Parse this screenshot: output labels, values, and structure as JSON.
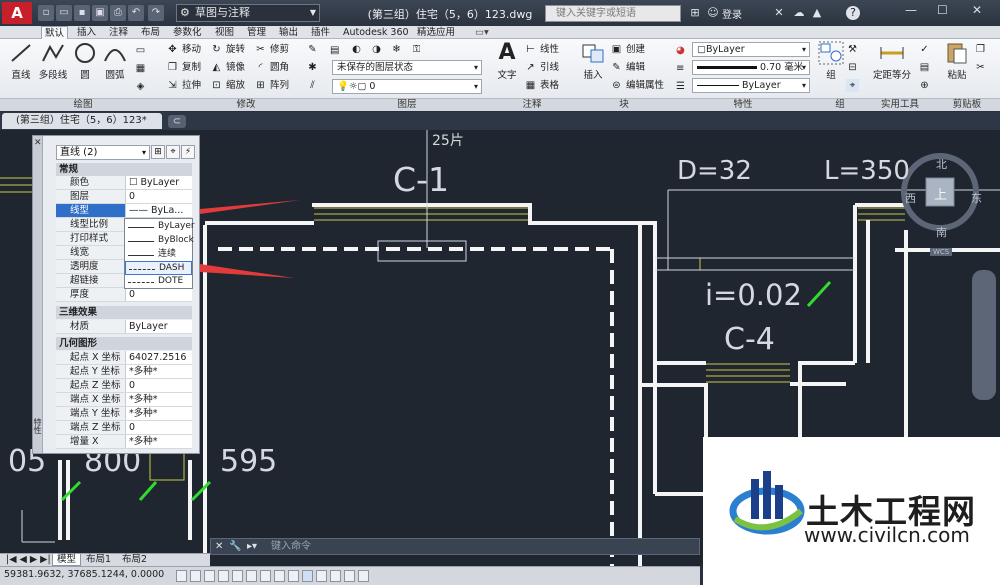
{
  "titlebar": {
    "logo": "A",
    "workspace": "草图与注释",
    "document_title": "(第三组）住宅（5，6）123.dwg",
    "search_placeholder": "键入关键字或短语",
    "login_label": "登录",
    "help_label": "?"
  },
  "menu_tabs": [
    "默认",
    "插入",
    "注释",
    "布局",
    "参数化",
    "视图",
    "管理",
    "输出",
    "插件",
    "Autodesk 360",
    "精选应用"
  ],
  "active_menu_tab": "默认",
  "ribbon": {
    "draw": {
      "title": "绘图",
      "buttons": [
        "直线",
        "多段线",
        "圆",
        "圆弧"
      ]
    },
    "modify": {
      "title": "修改",
      "tools": [
        "移动",
        "旋转",
        "修剪",
        "复制",
        "镜像",
        "圆角",
        "拉伸",
        "缩放",
        "阵列"
      ]
    },
    "layers": {
      "title": "图层",
      "layer_state": "未保存的图层状态",
      "current_layer": "0"
    },
    "annotation": {
      "title": "注释",
      "text_button": "文字",
      "tools": [
        "线性",
        "引线",
        "表格"
      ]
    },
    "block": {
      "title": "块",
      "insert_button": "插入",
      "tools": [
        "创建",
        "编辑",
        "编辑属性"
      ]
    },
    "properties": {
      "title": "特性",
      "color": "ByLayer",
      "lineweight": "0.70 毫米",
      "linetype": "ByLayer"
    },
    "groups": {
      "title": "组",
      "button": "组"
    },
    "utilities": {
      "title": "实用工具",
      "button": "定距等分"
    },
    "clipboard": {
      "title": "剪贴板",
      "button": "粘贴"
    }
  },
  "doc_tab": "(第三组）住宅（5，6）123*",
  "properties_palette": {
    "selection": "直线 (2)",
    "side_label": "特性",
    "sections": [
      {
        "name": "常规",
        "rows": [
          {
            "key": "颜色",
            "value": "☐ ByLayer"
          },
          {
            "key": "图层",
            "value": "0"
          },
          {
            "key": "线型",
            "value": "—— ByLa..."
          },
          {
            "key": "线型比例",
            "value": ""
          },
          {
            "key": "打印样式",
            "value": ""
          },
          {
            "key": "线宽",
            "value": ""
          },
          {
            "key": "透明度",
            "value": ""
          },
          {
            "key": "超链接",
            "value": ""
          },
          {
            "key": "厚度",
            "value": "0"
          }
        ]
      },
      {
        "name": "三维效果",
        "rows": [
          {
            "key": "材质",
            "value": "ByLayer"
          }
        ]
      },
      {
        "name": "几何图形",
        "rows": [
          {
            "key": "起点 X 坐标",
            "value": "64027.2516"
          },
          {
            "key": "起点 Y 坐标",
            "value": "*多种*"
          },
          {
            "key": "起点 Z 坐标",
            "value": "0"
          },
          {
            "key": "端点 X 坐标",
            "value": "*多种*"
          },
          {
            "key": "端点 Y 坐标",
            "value": "*多种*"
          },
          {
            "key": "端点 Z 坐标",
            "value": "0"
          },
          {
            "key": "增量 X",
            "value": "*多种*"
          }
        ]
      }
    ],
    "linetype_options": [
      "ByLayer",
      "ByBlock",
      "连续",
      "DASH",
      "DOTE"
    ],
    "linetype_selected": "DASH"
  },
  "drawing": {
    "labels": [
      "C-1",
      "D=32",
      "L=350",
      "i=0.02",
      "C-4",
      "05",
      "800",
      "595",
      "25片"
    ],
    "viewcube": {
      "north": "北",
      "south": "南",
      "east": "东",
      "west": "西",
      "top": "上",
      "wcs": "WCS"
    }
  },
  "command_line": {
    "placeholder": "键入命令"
  },
  "layout_tabs": [
    "模型",
    "布局1",
    "布局2"
  ],
  "active_layout_tab": "模型",
  "status": {
    "coordinates": "59381.9632, 37685.1244, 0.0000"
  },
  "watermark": {
    "title": "土木工程网",
    "url": "www.civilcn.com"
  },
  "colors": {
    "canvas": "#1f2630",
    "accent_blue": "#2f6fc7",
    "arrow_red": "#e23b3b",
    "marker_green": "#2fdc2f"
  }
}
